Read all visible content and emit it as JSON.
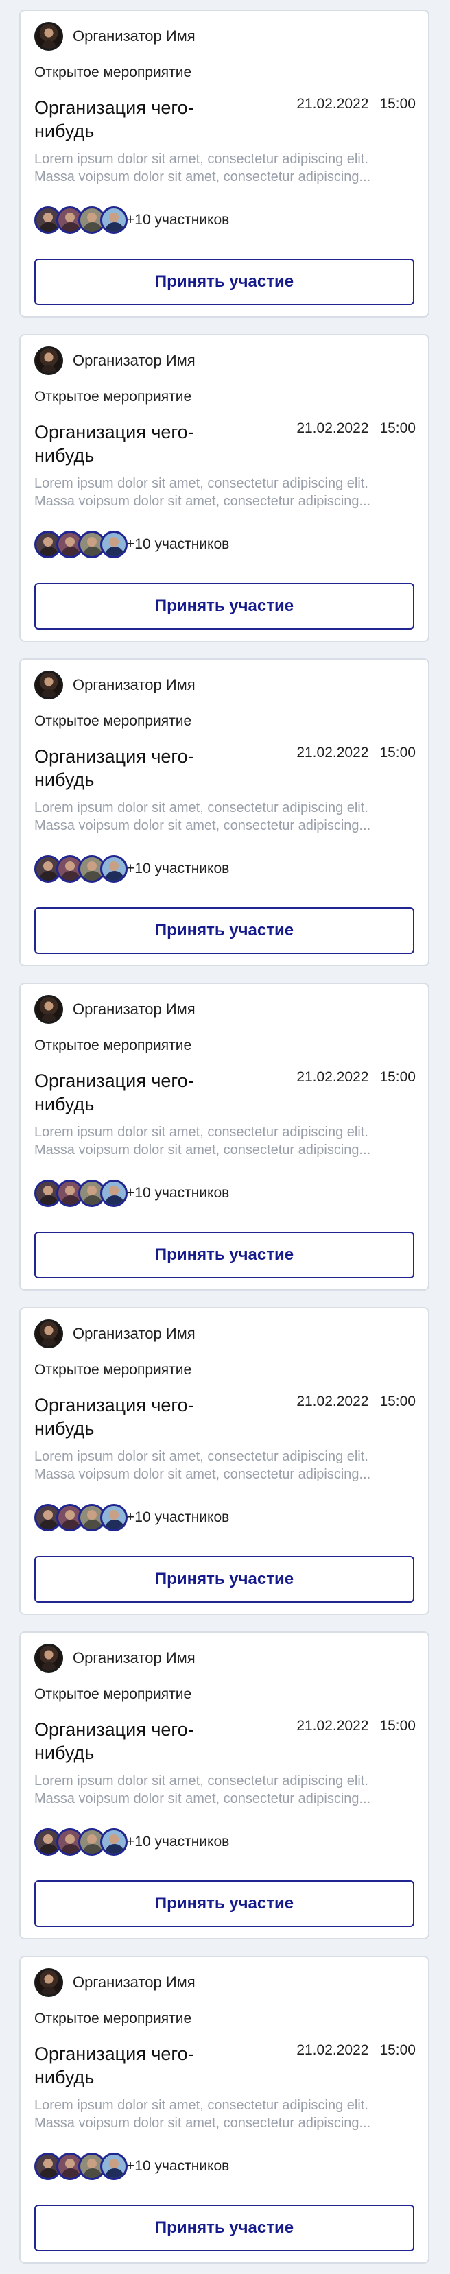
{
  "theme": {
    "accent": "#20258f",
    "muted_text": "#9aa0aa",
    "background": "#eef2f7",
    "card_background": "#ffffff"
  },
  "events": [
    {
      "organizer_name": "Организатор Имя",
      "type": "Открытое мероприятие",
      "title": "Организация чего-нибудь",
      "date": "21.02.2022",
      "time": "15:00",
      "description_line1": "Lorem ipsum dolor sit amet, consectetur adipiscing elit.",
      "description_line2": "Massa voipsum dolor sit amet, consectetur adipiscing...",
      "participants_label": "+10 участников",
      "join_label": "Принять участие"
    },
    {
      "organizer_name": "Организатор Имя",
      "type": "Открытое мероприятие",
      "title": "Организация чего-нибудь",
      "date": "21.02.2022",
      "time": "15:00",
      "description_line1": "Lorem ipsum dolor sit amet, consectetur adipiscing elit.",
      "description_line2": "Massa voipsum dolor sit amet, consectetur adipiscing...",
      "participants_label": "+10 участников",
      "join_label": "Принять участие"
    },
    {
      "organizer_name": "Организатор Имя",
      "type": "Открытое мероприятие",
      "title": "Организация чего-нибудь",
      "date": "21.02.2022",
      "time": "15:00",
      "description_line1": "Lorem ipsum dolor sit amet, consectetur adipiscing elit.",
      "description_line2": "Massa voipsum dolor sit amet, consectetur adipiscing...",
      "participants_label": "+10 участников",
      "join_label": "Принять участие"
    },
    {
      "organizer_name": "Организатор Имя",
      "type": "Открытое мероприятие",
      "title": "Организация чего-нибудь",
      "date": "21.02.2022",
      "time": "15:00",
      "description_line1": "Lorem ipsum dolor sit amet, consectetur adipiscing elit.",
      "description_line2": "Massa voipsum dolor sit amet, consectetur adipiscing...",
      "participants_label": "+10 участников",
      "join_label": "Принять участие"
    },
    {
      "organizer_name": "Организатор Имя",
      "type": "Открытое мероприятие",
      "title": "Организация чего-нибудь",
      "date": "21.02.2022",
      "time": "15:00",
      "description_line1": "Lorem ipsum dolor sit amet, consectetur adipiscing elit.",
      "description_line2": "Massa voipsum dolor sit amet, consectetur adipiscing...",
      "participants_label": "+10 участников",
      "join_label": "Принять участие"
    },
    {
      "organizer_name": "Организатор Имя",
      "type": "Открытое мероприятие",
      "title": "Организация чего-нибудь",
      "date": "21.02.2022",
      "time": "15:00",
      "description_line1": "Lorem ipsum dolor sit amet, consectetur adipiscing elit.",
      "description_line2": "Massa voipsum dolor sit amet, consectetur adipiscing...",
      "participants_label": "+10 участников",
      "join_label": "Принять участие"
    },
    {
      "organizer_name": "Организатор Имя",
      "type": "Открытое мероприятие",
      "title": "Организация чего-нибудь",
      "date": "21.02.2022",
      "time": "15:00",
      "description_line1": "Lorem ipsum dolor sit amet, consectetur adipiscing elit.",
      "description_line2": "Massa voipsum dolor sit amet, consectetur adipiscing...",
      "participants_label": "+10 участников",
      "join_label": "Принять участие"
    }
  ]
}
